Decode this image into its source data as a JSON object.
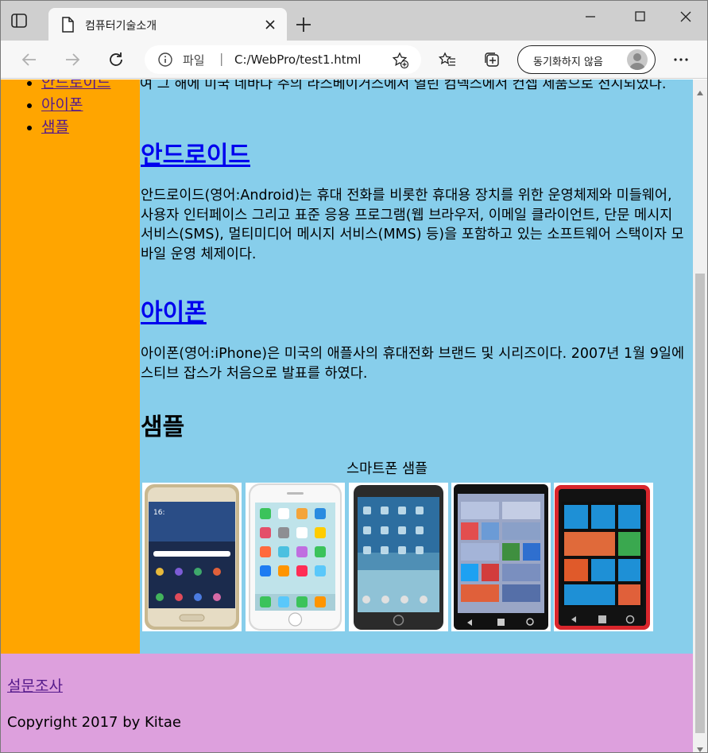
{
  "window": {
    "tab_title": "컴퓨터기술소개",
    "controls": [
      "minimize",
      "maximize",
      "close"
    ]
  },
  "toolbar": {
    "address_scheme_label": "파일",
    "address_separator": "|",
    "url": "C:/WebPro/test1.html",
    "sync_label": "동기화하지 않음"
  },
  "sidebar": {
    "items": [
      {
        "label": "안드로이드"
      },
      {
        "label": "아이폰"
      },
      {
        "label": "샘플"
      }
    ]
  },
  "main": {
    "intro_text": "여 그 해에 미국 네바다 주의 라스베이거스에서 열린 컴덱스에서 컨셉 제품으로 전시되었다.",
    "android": {
      "heading": "안드로이드",
      "body": "안드로이드(영어:Android)는 휴대 전화를 비롯한 휴대용 장치를 위한 운영체제와 미들웨어, 사용자 인터페이스 그리고 표준 응용 프로그램(웹 브라우저, 이메일 클라이언트, 단문 메시지 서비스(SMS), 멀티미디어 메시지 서비스(MMS) 등)을 포함하고 있는 소프트웨어 스택이자 모바일 운영 체제이다."
    },
    "iphone": {
      "heading": "아이폰",
      "body": "아이폰(영어:iPhone)은 미국의 애플사의 휴대전화 브랜드 및 시리즈이다. 2007년 1월 9일에 스티브 잡스가 처음으로 발표를 하였다."
    },
    "sample": {
      "heading": "샘플",
      "caption": "스마트폰 샘플",
      "phones": [
        "samsung-galaxy-phone",
        "iphone-white",
        "android-black-phone",
        "windows-phone-black",
        "nokia-lumia-red"
      ]
    }
  },
  "footer": {
    "survey_link": "설문조사",
    "copyright": "Copyright 2017 by Kitae"
  },
  "colors": {
    "sidebar_bg": "#ffa500",
    "main_bg": "#87ceeb",
    "footer_bg": "#dda0dd",
    "link_unvisited": "#0000ee",
    "link_visited": "#551a8b"
  }
}
